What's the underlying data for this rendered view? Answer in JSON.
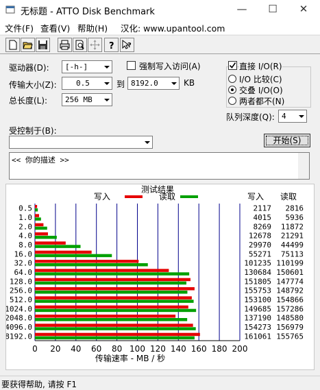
{
  "window": {
    "title": "无标题 - ATTO Disk Benchmark",
    "minimize": "—",
    "maximize": "☐",
    "close": "✕"
  },
  "menu": {
    "file": "文件(F)",
    "view": "查看(V)",
    "help": "帮助(H)",
    "locale": "汉化: www.upantool.com"
  },
  "toolbar": {
    "icons": [
      "new-icon",
      "open-icon",
      "save-icon",
      "print-icon",
      "print-preview-icon",
      "move-icon",
      "help-icon",
      "context-help-icon"
    ]
  },
  "settings": {
    "drive_label": "驱动器(D):",
    "drive_value": "[-h-]",
    "force_write_label": "强制写入访问(A)",
    "direct_io_label": "直接 I/O(R)",
    "transfer_size_label": "传输大小(Z):",
    "transfer_from": "0.5",
    "to_label": "到",
    "transfer_to": "8192.0",
    "kb_label": "KB",
    "total_length_label": "总长度(L):",
    "total_length_value": "256 MB",
    "io_compare_label": "I/O 比较(C)",
    "overlapped_io_label": "交叠 I/O(O)",
    "neither_label": "两者都不(N)",
    "queue_depth_label": "队列深度(Q):",
    "queue_depth_value": "4",
    "controlled_by_label": "受控制于(B):",
    "controlled_by_value": "",
    "start_button": "开始(S)",
    "description": "<<   你的描述   >>"
  },
  "chart_data": {
    "type": "bar",
    "orientation": "horizontal",
    "title": "测试结果",
    "xlabel": "传输速率 - MB / 秒",
    "xlim": [
      0,
      200
    ],
    "x_ticks": [
      "0",
      "20",
      "40",
      "60",
      "80",
      "100",
      "120",
      "140",
      "160",
      "180",
      "200"
    ],
    "categories": [
      "0.5",
      "1.0",
      "2.0",
      "4.0",
      "8.0",
      "16.0",
      "32.0",
      "64.0",
      "128.0",
      "256.0",
      "512.0",
      "1024.0",
      "2048.0",
      "4096.0",
      "8192.0"
    ],
    "series": [
      {
        "name": "写入",
        "color": "#e60000",
        "values": [
          2.1,
          4.0,
          8.3,
          12.7,
          30.0,
          55.3,
          101.2,
          130.7,
          151.8,
          155.8,
          153.1,
          149.7,
          137.2,
          154.3,
          161.1
        ]
      },
      {
        "name": "读取",
        "color": "#00a000",
        "values": [
          2.8,
          5.9,
          11.9,
          21.3,
          44.5,
          75.1,
          110.2,
          150.6,
          147.8,
          148.8,
          154.9,
          157.3,
          148.6,
          157.0,
          155.8
        ]
      }
    ],
    "table_headers": {
      "write": "写入",
      "read": "读取"
    },
    "table_write": [
      "2117",
      "4015",
      "8269",
      "12678",
      "29970",
      "55271",
      "101235",
      "130684",
      "151805",
      "155753",
      "153100",
      "149685",
      "137190",
      "154273",
      "161061"
    ],
    "table_read": [
      "2816",
      "5936",
      "11872",
      "21291",
      "44499",
      "75113",
      "110199",
      "150601",
      "147774",
      "148792",
      "154866",
      "157286",
      "148580",
      "156979",
      "155765"
    ],
    "grid": true,
    "legend": "top-center"
  },
  "status": "要获得帮助, 请按 F1"
}
